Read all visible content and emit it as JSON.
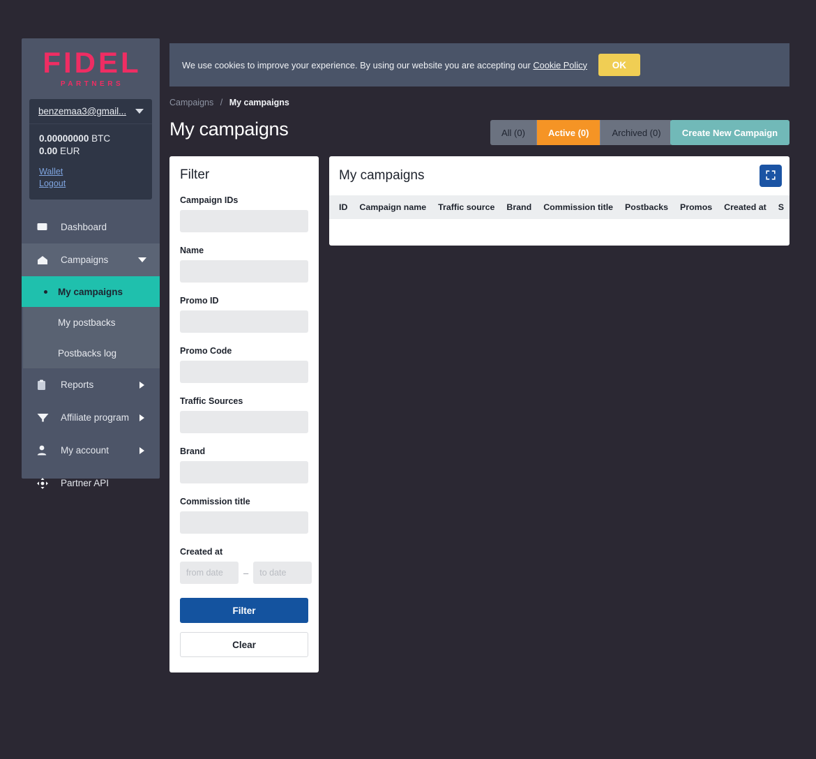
{
  "brand": {
    "name": "FIDEL",
    "tagline": "PARTNERS",
    "color": "#ef2d63"
  },
  "sidebar": {
    "user": {
      "email": "benzemaa3@gmail...",
      "caret_icon": "chevron-down-icon",
      "balances": [
        {
          "amount": "0.00000000",
          "currency": "BTC"
        },
        {
          "amount": "0.00",
          "currency": "EUR"
        }
      ],
      "links": [
        {
          "label": "Wallet",
          "name": "wallet-link"
        },
        {
          "label": "Logout",
          "name": "logout-link"
        }
      ]
    },
    "nav": [
      {
        "label": "Dashboard",
        "icon": "dashboard-icon",
        "state": "default",
        "arrow": "none"
      },
      {
        "label": "Campaigns",
        "icon": "home-icon",
        "state": "open",
        "arrow": "chevron-down-icon"
      },
      {
        "label": "Reports",
        "icon": "clipboard-icon",
        "state": "default",
        "arrow": "chevron-right-icon"
      },
      {
        "label": "Affiliate program",
        "icon": "funnel-icon",
        "state": "default",
        "arrow": "chevron-right-icon"
      },
      {
        "label": "My account",
        "icon": "user-icon",
        "state": "default",
        "arrow": "chevron-right-icon"
      },
      {
        "label": "Partner API",
        "icon": "move-arrows-icon",
        "state": "default",
        "arrow": "none"
      }
    ],
    "subnav": [
      {
        "label": "My campaigns",
        "active": true
      },
      {
        "label": "My postbacks",
        "active": false
      },
      {
        "label": "Postbacks log",
        "active": false
      }
    ]
  },
  "cookie": {
    "text_before": "We use cookies to improve your experience. By using our website you are accepting our ",
    "link_label": "Cookie Policy",
    "ok_label": "OK",
    "ok_color": "#f0ce54"
  },
  "breadcrumb": {
    "parent": "Campaigns",
    "separator": "/",
    "current": "My campaigns"
  },
  "page": {
    "title": "My campaigns"
  },
  "tabs": [
    {
      "label": "All (0)",
      "active": false
    },
    {
      "label": "Active (0)",
      "active": true
    },
    {
      "label": "Archived (0)",
      "active": false
    }
  ],
  "actions": {
    "create_label": "Create New Campaign",
    "create_color": "#71b9b8",
    "active_tab_color": "#f59425"
  },
  "filter": {
    "title": "Filter",
    "fields": [
      {
        "label": "Campaign IDs",
        "value": "",
        "placeholder": "",
        "name": "campaign-ids-input"
      },
      {
        "label": "Name",
        "value": "",
        "placeholder": "",
        "name": "name-input"
      },
      {
        "label": "Promo ID",
        "value": "",
        "placeholder": "",
        "name": "promo-id-input"
      },
      {
        "label": "Promo Code",
        "value": "",
        "placeholder": "",
        "name": "promo-code-input"
      },
      {
        "label": "Traffic Sources",
        "value": "",
        "placeholder": "",
        "name": "traffic-sources-input"
      },
      {
        "label": "Brand",
        "value": "",
        "placeholder": "",
        "name": "brand-input"
      },
      {
        "label": "Commission title",
        "value": "",
        "placeholder": "",
        "name": "commission-title-input"
      }
    ],
    "created_at": {
      "label": "Created at",
      "from_placeholder": "from date",
      "from_value": "",
      "to_placeholder": "to date",
      "to_value": "",
      "dash": "–"
    },
    "submit_label": "Filter",
    "clear_label": "Clear",
    "submit_color": "#14539f"
  },
  "table": {
    "title": "My campaigns",
    "expand_icon": "expand-fullscreen-icon",
    "columns": [
      "ID",
      "Campaign name",
      "Traffic source",
      "Brand",
      "Commission title",
      "Postbacks",
      "Promos",
      "Created at",
      "S"
    ],
    "rows": []
  }
}
